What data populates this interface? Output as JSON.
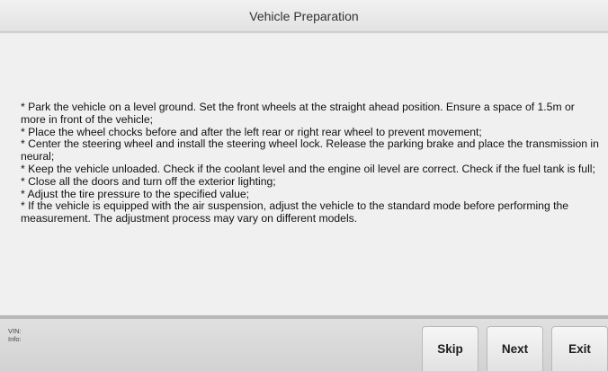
{
  "window": {
    "title": "Vehicle Preparation"
  },
  "instructions": [
    "* Park the vehicle on a level ground. Set the front wheels at the straight ahead position. Ensure a space of 1.5m or more in front of the vehicle;",
    "* Place the wheel chocks before and after the left rear or right rear wheel to prevent movement;",
    "* Center the steering wheel and install the steering wheel lock. Release the parking brake and place the transmission in neural;",
    "* Keep the vehicle unloaded. Check if the coolant level and the engine oil level are correct. Check if the fuel tank is full;",
    "* Close all the doors and turn off the exterior lighting;",
    "* Adjust the tire pressure to the specified value;",
    "* If the vehicle is equipped with the air suspension, adjust the vehicle to the standard mode before performing the measurement. The adjustment process may vary on different models."
  ],
  "footer": {
    "vin_label": "VIN:",
    "info_label": "Info:",
    "buttons": {
      "skip": "Skip",
      "next": "Next",
      "exit": "Exit"
    }
  },
  "colors": {
    "content_background": "#f0f0f0",
    "title_bar": "#e8e8e8",
    "footer_background": "#d8d8d8"
  }
}
